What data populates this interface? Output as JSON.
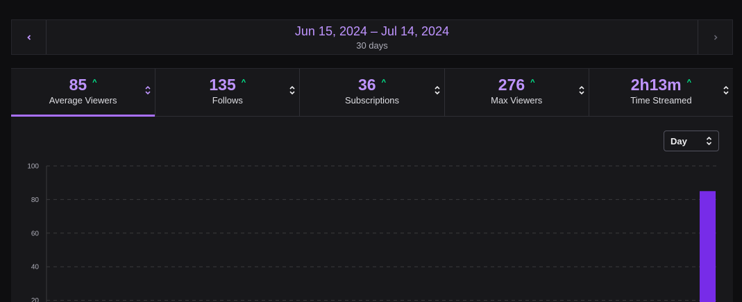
{
  "date_nav": {
    "range": "Jun 15, 2024 – Jul 14, 2024",
    "subtitle": "30 days",
    "prev_icon": "chevron-left-icon",
    "next_icon": "chevron-right-icon"
  },
  "tabs": [
    {
      "value": "85",
      "label": "Average Viewers",
      "trend": "up",
      "active": true
    },
    {
      "value": "135",
      "label": "Follows",
      "trend": "up",
      "active": false
    },
    {
      "value": "36",
      "label": "Subscriptions",
      "trend": "up",
      "active": false
    },
    {
      "value": "276",
      "label": "Max Viewers",
      "trend": "up",
      "active": false
    },
    {
      "value": "2h13m",
      "label": "Time Streamed",
      "trend": "up",
      "active": false
    }
  ],
  "granularity": {
    "selected": "Day"
  },
  "colors": {
    "accent": "#a970ff",
    "value": "#bf94ff",
    "trend_up": "#00f593",
    "bar": "#772ce8"
  },
  "chart_data": {
    "type": "bar",
    "series": [
      {
        "values": [
          85
        ]
      }
    ],
    "bar_position": "last",
    "yticks": [
      "100",
      "80",
      "60",
      "40",
      "20"
    ],
    "ylim": [
      0,
      100
    ],
    "grid": true
  }
}
